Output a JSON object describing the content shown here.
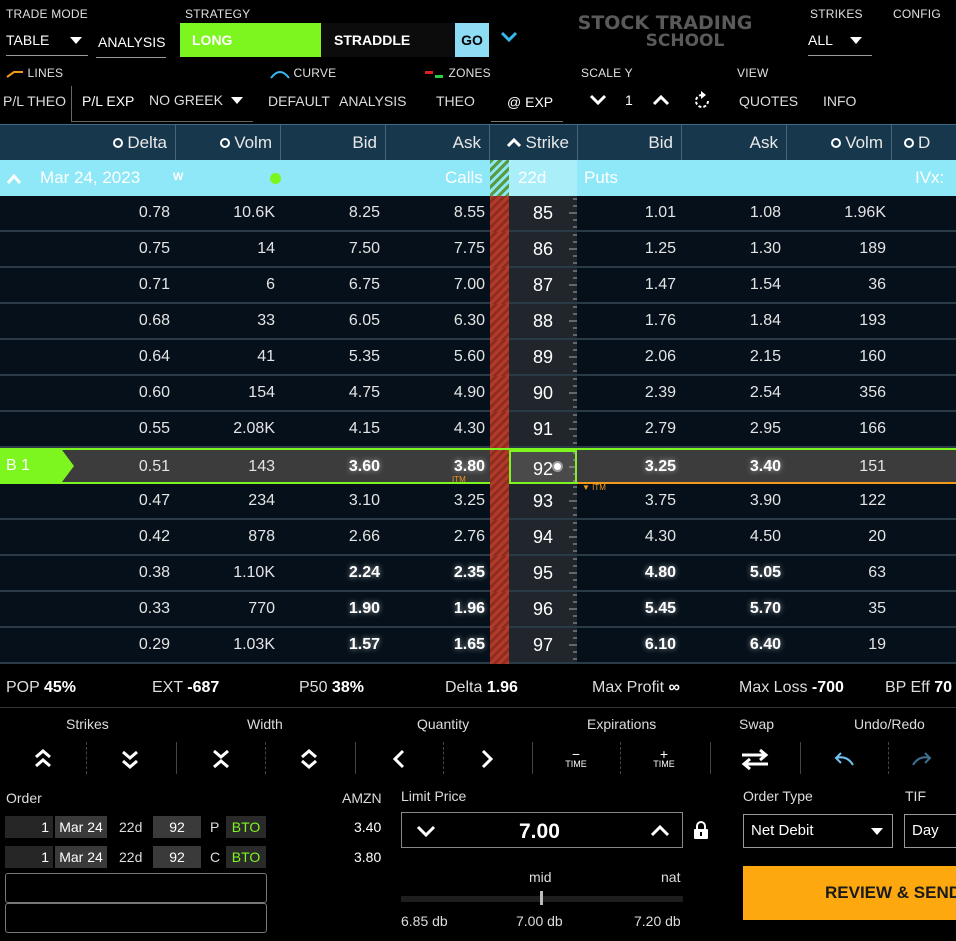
{
  "top": {
    "trade_mode_label": "TRADE MODE",
    "trade_mode_value": "TABLE",
    "analysis_label": "ANALYSIS",
    "strategy_label": "STRATEGY",
    "strategy_long": "LONG",
    "strategy_straddle": "STRADDLE",
    "go": "GO",
    "logo_line1": "STOCK TRADING",
    "logo_line2": "SCHOOL",
    "strikes_label": "STRIKES",
    "strikes_value": "ALL",
    "config_label": "CONFIG"
  },
  "second": {
    "lines": "LINES",
    "curve": "CURVE",
    "zones": "ZONES",
    "scale_y": "SCALE Y",
    "view": "VIEW",
    "pl_theo": "P/L THEO",
    "pl_exp": "P/L EXP",
    "no_greek": "NO GREEK",
    "default": "DEFAULT",
    "analysis": "ANALYSIS",
    "theo": "THEO",
    "at_exp": "@ EXP",
    "scale_value": "1",
    "quotes": "QUOTES",
    "info": "INFO"
  },
  "columns": {
    "delta": "Delta",
    "volm": "Volm",
    "bid": "Bid",
    "ask": "Ask",
    "strike": "Strike",
    "put_bid": "Bid",
    "put_ask": "Ask",
    "put_volm": "Volm",
    "put_delta": "D"
  },
  "expiration": {
    "date": "Mar 24, 2023",
    "tag": "W",
    "calls": "Calls",
    "dte": "22d",
    "puts": "Puts",
    "ivx": "IVx:"
  },
  "rows": [
    {
      "delta": "0.78",
      "volm": "10.6K",
      "bid": "8.25",
      "ask": "8.55",
      "strike": "85",
      "pbid": "1.01",
      "pask": "1.08",
      "pvolm": "1.96K"
    },
    {
      "delta": "0.75",
      "volm": "14",
      "bid": "7.50",
      "ask": "7.75",
      "strike": "86",
      "pbid": "1.25",
      "pask": "1.30",
      "pvolm": "189"
    },
    {
      "delta": "0.71",
      "volm": "6",
      "bid": "6.75",
      "ask": "7.00",
      "strike": "87",
      "pbid": "1.47",
      "pask": "1.54",
      "pvolm": "36"
    },
    {
      "delta": "0.68",
      "volm": "33",
      "bid": "6.05",
      "ask": "6.30",
      "strike": "88",
      "pbid": "1.76",
      "pask": "1.84",
      "pvolm": "193"
    },
    {
      "delta": "0.64",
      "volm": "41",
      "bid": "5.35",
      "ask": "5.60",
      "strike": "89",
      "pbid": "2.06",
      "pask": "2.15",
      "pvolm": "160"
    },
    {
      "delta": "0.60",
      "volm": "154",
      "bid": "4.75",
      "ask": "4.90",
      "strike": "90",
      "pbid": "2.39",
      "pask": "2.54",
      "pvolm": "356"
    },
    {
      "delta": "0.55",
      "volm": "2.08K",
      "bid": "4.15",
      "ask": "4.30",
      "strike": "91",
      "pbid": "2.79",
      "pask": "2.95",
      "pvolm": "166"
    },
    {
      "delta": "0.51",
      "volm": "143",
      "bid": "3.60",
      "ask": "3.80",
      "strike": "92",
      "pbid": "3.25",
      "pask": "3.40",
      "pvolm": "151",
      "tag": "B 1"
    },
    {
      "delta": "0.47",
      "volm": "234",
      "bid": "3.10",
      "ask": "3.25",
      "strike": "93",
      "pbid": "3.75",
      "pask": "3.90",
      "pvolm": "122"
    },
    {
      "delta": "0.42",
      "volm": "878",
      "bid": "2.66",
      "ask": "2.76",
      "strike": "94",
      "pbid": "4.30",
      "pask": "4.50",
      "pvolm": "20"
    },
    {
      "delta": "0.38",
      "volm": "1.10K",
      "bid": "2.24",
      "ask": "2.35",
      "strike": "95",
      "pbid": "4.80",
      "pask": "5.05",
      "pvolm": "63"
    },
    {
      "delta": "0.33",
      "volm": "770",
      "bid": "1.90",
      "ask": "1.96",
      "strike": "96",
      "pbid": "5.45",
      "pask": "5.70",
      "pvolm": "35"
    },
    {
      "delta": "0.29",
      "volm": "1.03K",
      "bid": "1.57",
      "ask": "1.65",
      "strike": "97",
      "pbid": "6.10",
      "pask": "6.40",
      "pvolm": "19"
    }
  ],
  "itm_label": "ITM",
  "stats": {
    "pop_label": "POP",
    "pop": "45%",
    "ext_label": "EXT",
    "ext": "-687",
    "p50_label": "P50",
    "p50": "38%",
    "delta_label": "Delta",
    "delta": "1.96",
    "maxprofit_label": "Max Profit",
    "maxprofit": "∞",
    "maxloss_label": "Max Loss",
    "maxloss": "-700",
    "bpeff_label": "BP Eff",
    "bpeff": "70"
  },
  "controls": {
    "strikes": "Strikes",
    "width": "Width",
    "quantity": "Quantity",
    "expirations": "Expirations",
    "swap": "Swap",
    "undo_redo": "Undo/Redo",
    "time": "TIME"
  },
  "order": {
    "label": "Order",
    "symbol": "AMZN",
    "legs": [
      {
        "qty": "1",
        "exp": "Mar 24",
        "dte": "22d",
        "strike": "92",
        "type": "P",
        "action": "BTO",
        "price": "3.40"
      },
      {
        "qty": "1",
        "exp": "Mar 24",
        "dte": "22d",
        "strike": "92",
        "type": "C",
        "action": "BTO",
        "price": "3.80"
      }
    ],
    "limit_label": "Limit Price",
    "limit_value": "7.00",
    "mid": "mid",
    "nat": "nat",
    "low": "6.85 db",
    "center": "7.00 db",
    "high": "7.20 db",
    "order_type_label": "Order Type",
    "order_type": "Net Debit",
    "tif_label": "TIF",
    "tif": "Day",
    "review": "REVIEW & SEND"
  }
}
